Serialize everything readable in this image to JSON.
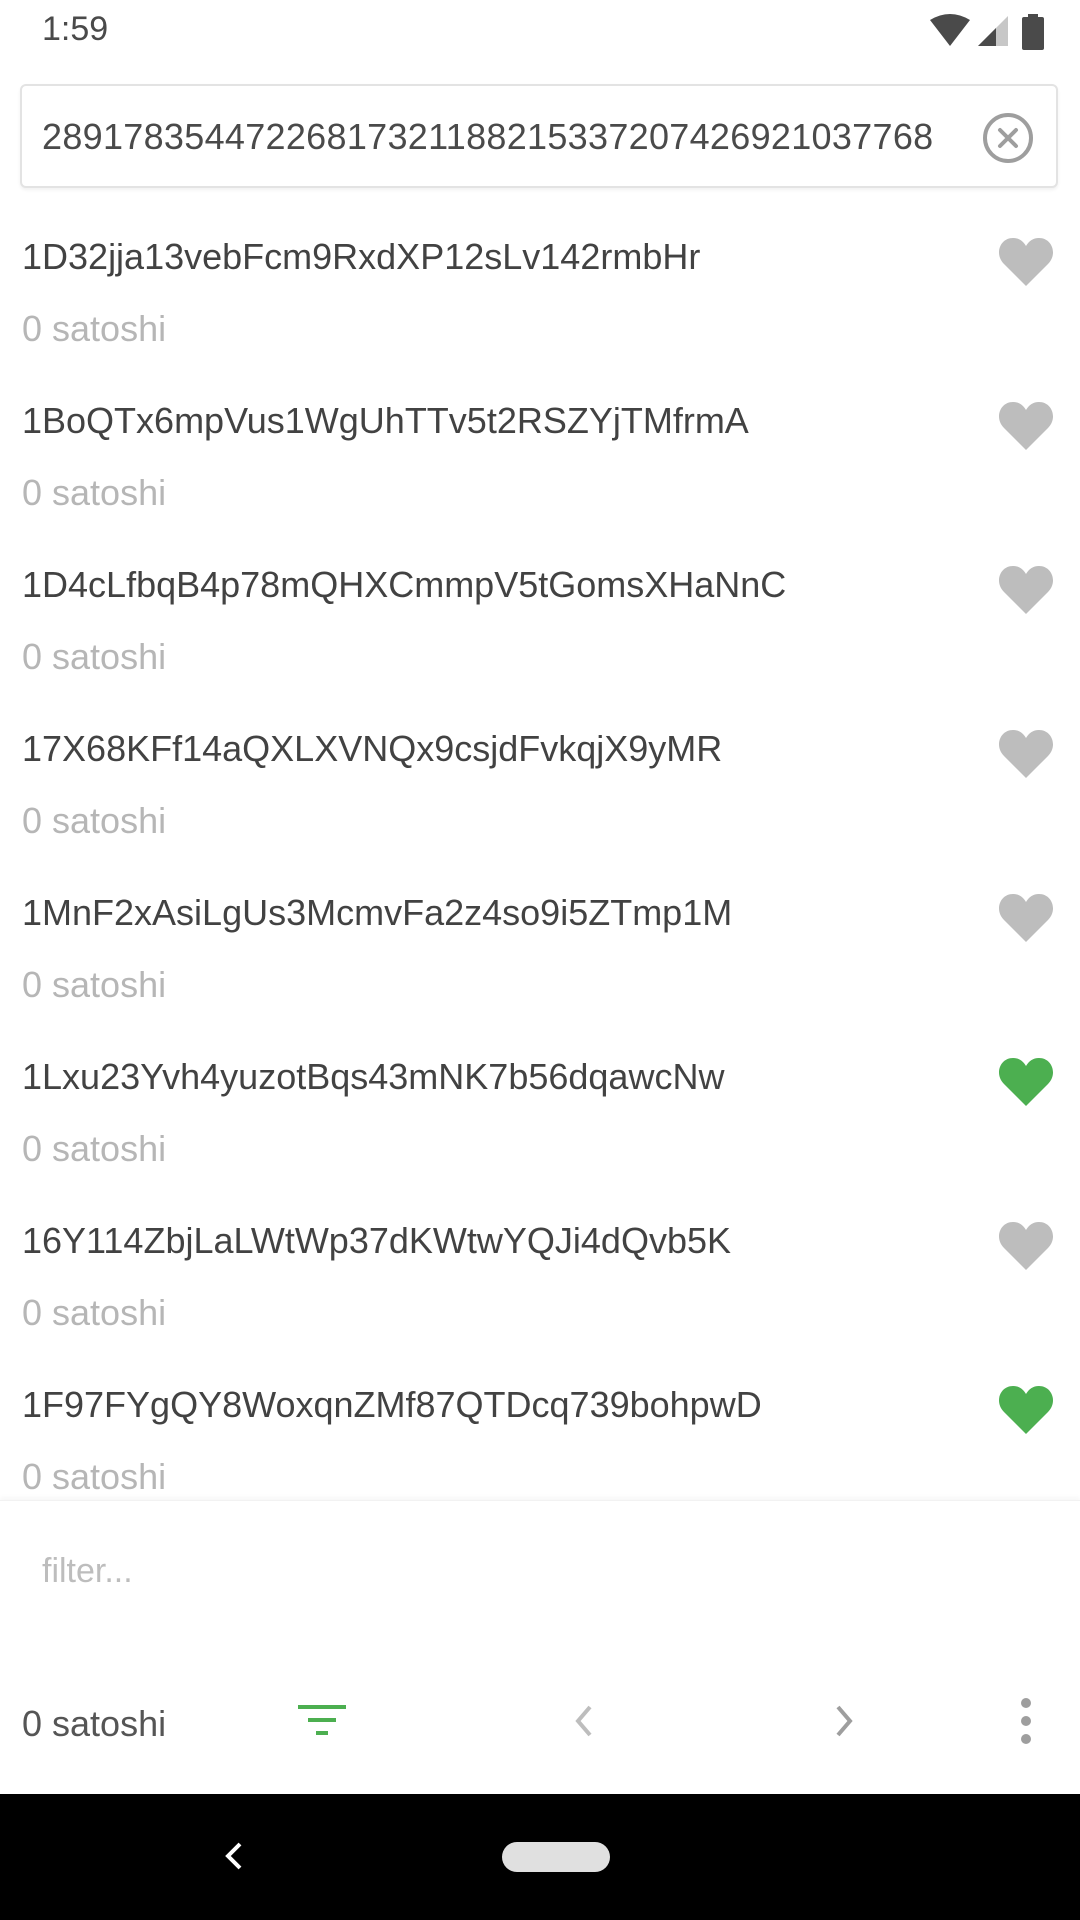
{
  "status_bar": {
    "time": "1:59",
    "icons": [
      "wifi-icon",
      "signal-icon",
      "battery-icon"
    ]
  },
  "search": {
    "value": "28917835447226817321188215337207426921037768"
  },
  "addresses": [
    {
      "address": "1D32jja13vebFcm9RxdXP12sLv142rmbHr",
      "balance": "0 satoshi",
      "favorite": false
    },
    {
      "address": "1BoQTx6mpVus1WgUhTTv5t2RSZYjTMfrmA",
      "balance": "0 satoshi",
      "favorite": false
    },
    {
      "address": "1D4cLfbqB4p78mQHXCmmpV5tGomsXHaNnC",
      "balance": "0 satoshi",
      "favorite": false
    },
    {
      "address": "17X68KFf14aQXLXVNQx9csjdFvkqjX9yMR",
      "balance": "0 satoshi",
      "favorite": false
    },
    {
      "address": "1MnF2xAsiLgUs3McmvFa2z4so9i5ZTmp1M",
      "balance": "0 satoshi",
      "favorite": false
    },
    {
      "address": "1Lxu23Yvh4yuzotBqs43mNK7b56dqawcNw",
      "balance": "0 satoshi",
      "favorite": true
    },
    {
      "address": "16Y114ZbjLaLWtWp37dKWtwYQJi4dQvb5K",
      "balance": "0 satoshi",
      "favorite": false
    },
    {
      "address": "1F97FYgQY8WoxqnZMf87QTDcq739bohpwD",
      "balance": "0 satoshi",
      "favorite": true
    }
  ],
  "filter": {
    "placeholder": "filter...",
    "value": ""
  },
  "bottom_bar": {
    "total_balance": "0 satoshi",
    "icons": [
      "filter-icon",
      "chevron-left-icon",
      "chevron-right-icon",
      "more-vert-icon"
    ]
  },
  "colors": {
    "accent": "#4caf50",
    "heart_inactive": "#bdbdbd",
    "secondary_text": "#b6b6b6"
  }
}
